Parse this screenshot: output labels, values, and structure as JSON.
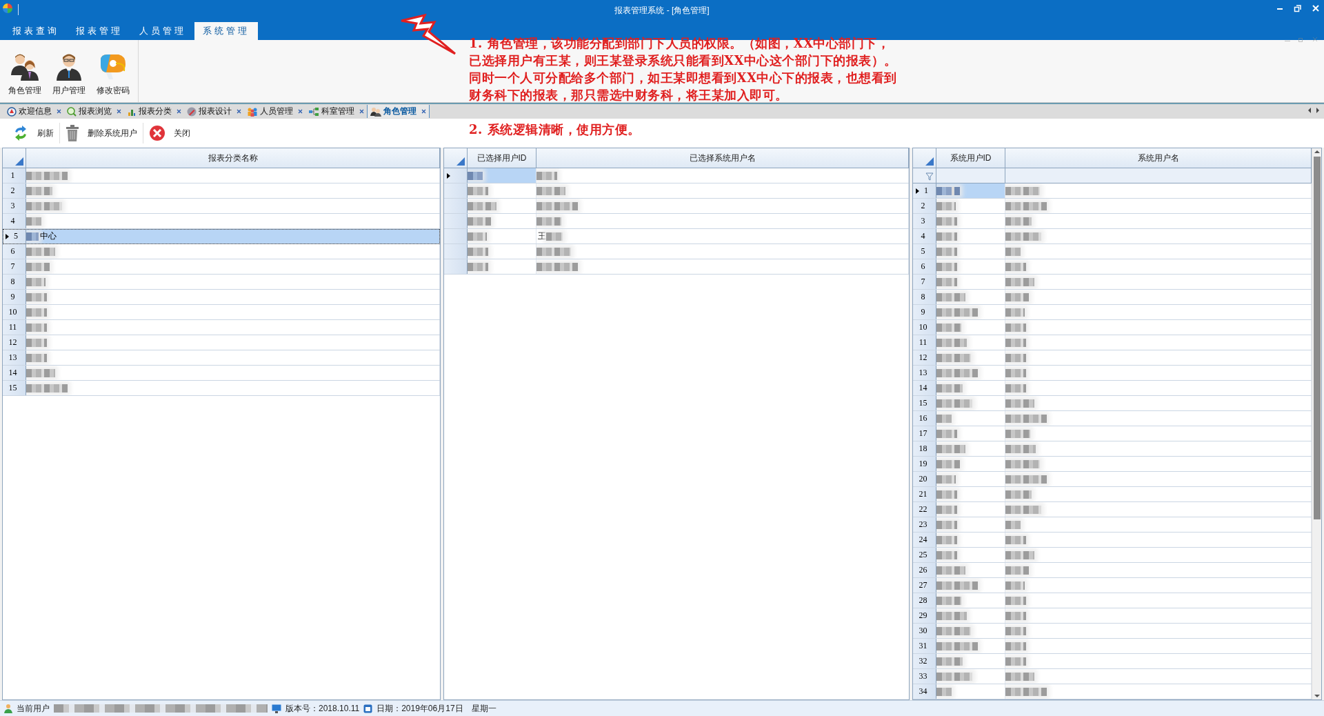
{
  "window": {
    "title": "报表管理系统 - [角色管理]"
  },
  "ribbon_tabs": [
    {
      "label": "报表查询",
      "selected": false
    },
    {
      "label": "报表管理",
      "selected": false
    },
    {
      "label": "人员管理",
      "selected": false
    },
    {
      "label": "系统管理",
      "selected": true
    }
  ],
  "ribbon_buttons": [
    {
      "label": "角色管理",
      "kind": "roles"
    },
    {
      "label": "用户管理",
      "kind": "user"
    },
    {
      "label": "修改密码",
      "kind": "password"
    }
  ],
  "doc_tabs": [
    {
      "label": "欢迎信息",
      "kind": "welcome",
      "selected": false
    },
    {
      "label": "报表浏览",
      "kind": "browse",
      "selected": false
    },
    {
      "label": "报表分类",
      "kind": "chart",
      "selected": false
    },
    {
      "label": "报表设计",
      "kind": "design",
      "selected": false
    },
    {
      "label": "人员管理",
      "kind": "people",
      "selected": false
    },
    {
      "label": "科室管理",
      "kind": "org",
      "selected": false
    },
    {
      "label": "角色管理",
      "kind": "roles",
      "selected": true
    }
  ],
  "toolbar": [
    {
      "label": "刷新",
      "kind": "refresh"
    },
    {
      "label": "删除系统用户",
      "kind": "delete"
    },
    {
      "label": "关闭",
      "kind": "close"
    }
  ],
  "annotations": [
    {
      "lines": [
        "1. 角色管理，该功能分配到部门下人员的权限。（如图，XX中心部门下，",
        "已选择用户有王某，则王某登录系统只能看到XX中心这个部门下的报表）。",
        "同时一个人可分配给多个部门，如王某即想看到XX中心下的报表，也想看到",
        "财务科下的报表，那只需选中财务科，将王某加入即可。"
      ]
    },
    {
      "lines": [
        "2. 系统逻辑清晰，使用方便。"
      ]
    }
  ],
  "grids": [
    {
      "columns": [
        "报表分类名称"
      ],
      "rows": [
        {
          "number": "1",
          "selected": false
        },
        {
          "number": "2",
          "selected": false
        },
        {
          "number": "3",
          "selected": false
        },
        {
          "number": "4",
          "selected": false
        },
        {
          "number": "5",
          "text": "中心",
          "selected": true
        },
        {
          "number": "6",
          "selected": false
        },
        {
          "number": "7",
          "selected": false
        },
        {
          "number": "8",
          "selected": false
        },
        {
          "number": "9",
          "selected": false
        },
        {
          "number": "10",
          "selected": false
        },
        {
          "number": "11",
          "selected": false
        },
        {
          "number": "12",
          "selected": false
        },
        {
          "number": "13",
          "selected": false
        },
        {
          "number": "14",
          "selected": false
        },
        {
          "number": "15",
          "selected": false
        }
      ]
    },
    {
      "columns": [
        "已选择用户ID",
        "已选择系统用户名"
      ],
      "rows": [
        {
          "selected": true
        },
        {
          "selected": false
        },
        {
          "selected": false
        },
        {
          "selected": false
        },
        {
          "text_2": "王",
          "selected": false
        },
        {
          "selected": false
        },
        {
          "selected": false
        }
      ]
    },
    {
      "columns": [
        "系统用户ID",
        "系统用户名"
      ],
      "rows": [
        {
          "number": "1",
          "selected": true
        },
        {
          "number": "2",
          "selected": false
        },
        {
          "number": "3",
          "selected": false
        },
        {
          "number": "4",
          "selected": false
        },
        {
          "number": "5",
          "selected": false
        },
        {
          "number": "6",
          "selected": false
        },
        {
          "number": "7",
          "selected": false
        },
        {
          "number": "8",
          "selected": false
        },
        {
          "number": "9",
          "selected": false
        },
        {
          "number": "10",
          "selected": false
        },
        {
          "number": "11",
          "selected": false
        },
        {
          "number": "12",
          "selected": false
        },
        {
          "number": "13",
          "selected": false
        },
        {
          "number": "14",
          "selected": false
        },
        {
          "number": "15",
          "selected": false
        },
        {
          "number": "16",
          "selected": false
        },
        {
          "number": "17",
          "selected": false
        },
        {
          "number": "18",
          "selected": false
        },
        {
          "number": "19",
          "selected": false
        },
        {
          "number": "20",
          "selected": false
        },
        {
          "number": "21",
          "selected": false
        },
        {
          "number": "22",
          "selected": false
        },
        {
          "number": "23",
          "selected": false
        },
        {
          "number": "24",
          "selected": false
        },
        {
          "number": "25",
          "selected": false
        },
        {
          "number": "26",
          "selected": false
        },
        {
          "number": "27",
          "selected": false
        },
        {
          "number": "28",
          "selected": false
        },
        {
          "number": "29",
          "selected": false
        },
        {
          "number": "30",
          "selected": false
        },
        {
          "number": "31",
          "selected": false
        },
        {
          "number": "32",
          "selected": false
        },
        {
          "number": "33",
          "selected": false
        },
        {
          "number": "34",
          "selected": false
        }
      ]
    }
  ],
  "status_bar": {
    "user_label": "当前用户",
    "version": "版本号：2018.10.11",
    "date": "日期：2019年06月17日",
    "weekday": "星期一"
  }
}
